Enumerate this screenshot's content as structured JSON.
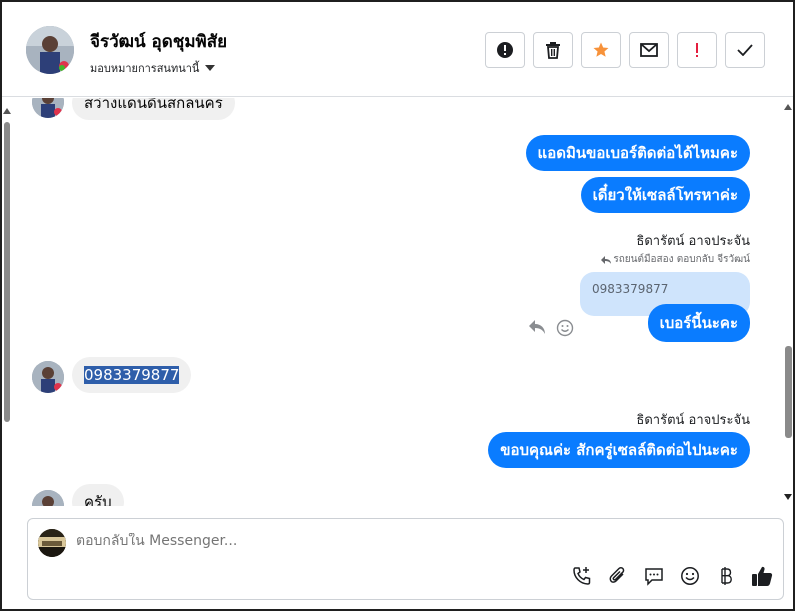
{
  "header": {
    "contact_name": "จีรวัฒน์ อุดชุมพิสัย",
    "assign_label": "มอบหมายการสนทนานี้",
    "actions": [
      {
        "name": "mark-spam-button",
        "icon": "exclamation-circle-icon"
      },
      {
        "name": "delete-button",
        "icon": "trash-icon"
      },
      {
        "name": "star-button",
        "icon": "star-icon"
      },
      {
        "name": "mark-unread-button",
        "icon": "envelope-icon"
      },
      {
        "name": "follow-up-button",
        "icon": "exclamation-icon"
      },
      {
        "name": "mark-done-button",
        "icon": "check-icon"
      }
    ]
  },
  "messages": {
    "m1_text": "สว่างแดนดินสกลนคร",
    "m2_text": "แอดมินขอเบอร์ติดต่อได้ไหมคะ",
    "m3_text": "เดี๋ยวให้เซลล์โทรหาค่ะ",
    "m4_sender": "ธิดารัตน์ อาจประจัน",
    "m4_reply_ctx": "รถยนต์มือสอง ตอบกลับ จีรวัฒน์",
    "m4_quoted": "0983379877",
    "m4_text": "เบอร์นี้นะคะ",
    "m5_text": "0983379877",
    "m6_sender": "ธิดารัตน์ อาจประจัน",
    "m6_text": "ขอบคุณค่ะ สักครู่เซลล์ติดต่อไปนะคะ",
    "m7_text": "ครับ"
  },
  "composer": {
    "placeholder": "ตอบกลับใน Messenger...",
    "tools": [
      "add-call-icon",
      "attachment-icon",
      "saved-reply-icon",
      "emoji-icon",
      "baht-payment-icon",
      "thumbs-up-icon"
    ]
  },
  "colors": {
    "outgoing_bubble": "#0a7cff",
    "incoming_bubble": "#f0f0f0",
    "star": "#f7923a",
    "alert_red": "#e41e3f"
  }
}
